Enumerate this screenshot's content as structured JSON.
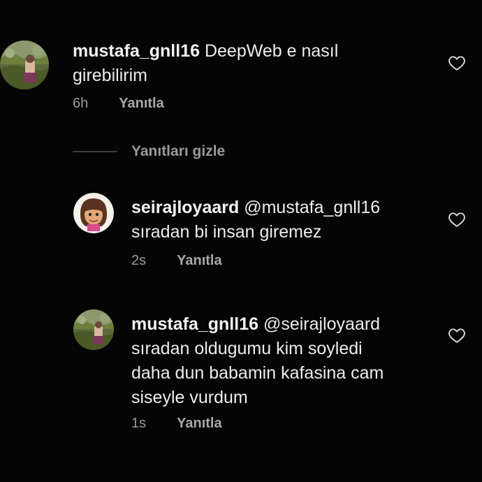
{
  "comments": [
    {
      "username": "mustafa_gnll16",
      "lines": [
        "DeepWeb e nasıl",
        "girebilirim"
      ],
      "time": "6h",
      "reply_label": "Yanıtla",
      "avatar_icon": "landscape-photo-avatar"
    },
    {
      "username": "seirajloyaard",
      "lines": [
        "@mustafa_gnll16",
        "sıradan bi insan giremez"
      ],
      "time": "2s",
      "reply_label": "Yanıtla",
      "avatar_icon": "cartoon-character-avatar"
    },
    {
      "username": "mustafa_gnll16",
      "lines": [
        "@seirajloyaard",
        "sıradan oldugumu kim soyledi",
        "daha dun babamin kafasina cam",
        "siseyle vurdum"
      ],
      "time": "1s",
      "reply_label": "Yanıtla",
      "avatar_icon": "landscape-photo-avatar"
    }
  ],
  "hide_replies_label": "Yanıtları gizle",
  "like_icon": "heart-outline-icon",
  "colors": {
    "background": "#050505",
    "text": "#ececec",
    "muted": "#9a9a9a"
  }
}
